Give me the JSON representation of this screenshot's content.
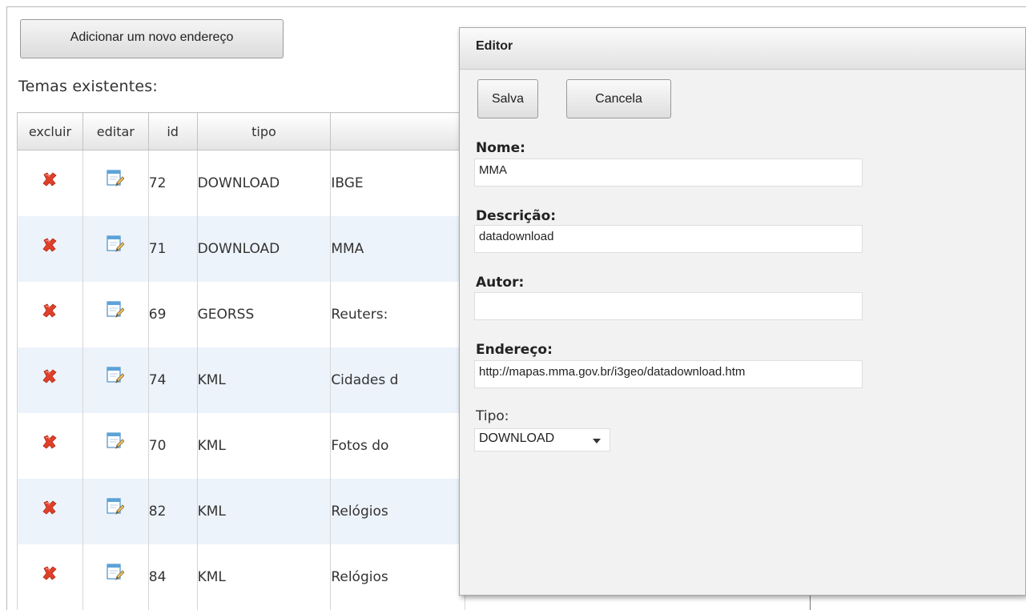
{
  "toolbar": {
    "add_label": "Adicionar um novo endereço"
  },
  "section": {
    "title": "Temas existentes:"
  },
  "table": {
    "columns": [
      "excluir",
      "editar",
      "id",
      "tipo",
      ""
    ],
    "rows": [
      {
        "id": "72",
        "tipo": "DOWNLOAD",
        "nome": "IBGE"
      },
      {
        "id": "71",
        "tipo": "DOWNLOAD",
        "nome": "MMA"
      },
      {
        "id": "69",
        "tipo": "GEORSS",
        "nome": "Reuters:"
      },
      {
        "id": "74",
        "tipo": "KML",
        "nome": "Cidades d"
      },
      {
        "id": "70",
        "tipo": "KML",
        "nome": "Fotos do"
      },
      {
        "id": "82",
        "tipo": "KML",
        "nome": "Relógios"
      },
      {
        "id": "84",
        "tipo": "KML",
        "nome": "Relógios"
      }
    ],
    "icons": {
      "delete": "delete-x-icon",
      "edit": "edit-pencil-icon"
    },
    "colors": {
      "delete_icon": "#e0402a",
      "row_alt": "#edf3fb"
    }
  },
  "dialog": {
    "title": "Editor",
    "save_label": "Salva",
    "cancel_label": "Cancela",
    "fields": {
      "nome": {
        "label": "Nome:",
        "value": "MMA"
      },
      "descricao": {
        "label": "Descrição:",
        "value": "datadownload"
      },
      "autor": {
        "label": "Autor:",
        "value": ""
      },
      "endereco": {
        "label": "Endereço:",
        "value": "http://mapas.mma.gov.br/i3geo/datadownload.htm"
      }
    },
    "tipo": {
      "label": "Tipo:",
      "selected": "DOWNLOAD"
    }
  }
}
